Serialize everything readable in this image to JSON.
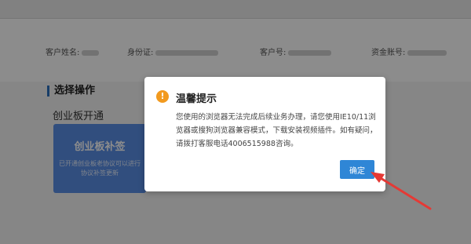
{
  "customer_info": {
    "name_label": "客户姓名:",
    "id_label": "身份证:",
    "customer_no_label": "客户号:",
    "account_label": "资金账号:"
  },
  "section": {
    "title": "选择操作",
    "subtitle": "创业板开通"
  },
  "card": {
    "title": "创业板补签",
    "description": "已开通创业板老协议可以进行协议补签更新"
  },
  "dialog": {
    "icon": "warning-icon",
    "title": "温馨提示",
    "message": "您使用的浏览器无法完成后续业务办理，请您使用IE10/11浏览器或搜狗浏览器兼容模式，下载安装视频插件。如有疑问，请拨打客服电话4006515988咨询。",
    "ok_label": "确定"
  },
  "colors": {
    "accent": "#2f86d6",
    "warning": "#f29a1f",
    "annotation_arrow": "#e53935",
    "card": "#5a8ee6"
  }
}
